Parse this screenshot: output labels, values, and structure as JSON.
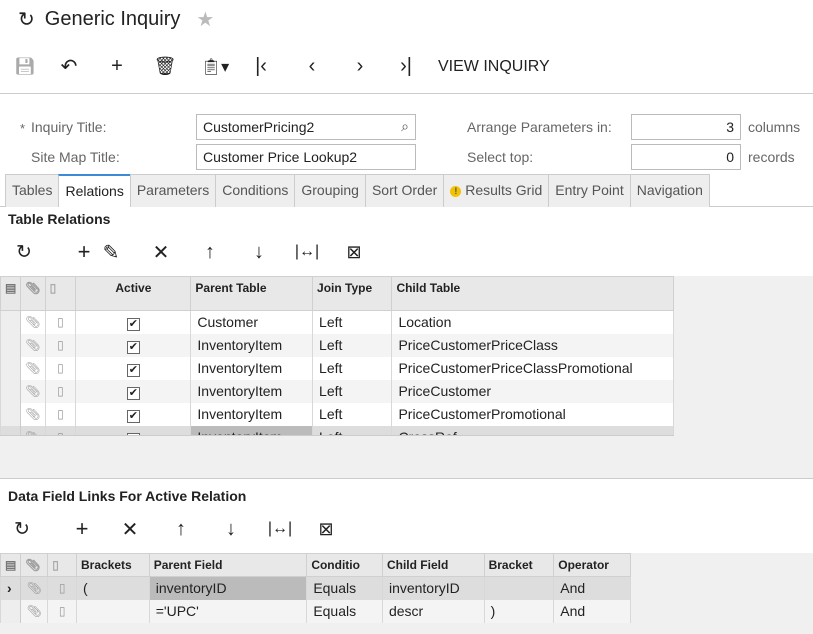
{
  "header": {
    "title": "Generic Inquiry",
    "view_inquiry": "VIEW INQUIRY"
  },
  "form": {
    "inquiry_title_label": "Inquiry Title:",
    "inquiry_title": "CustomerPricing2",
    "site_map_title_label": "Site Map Title:",
    "site_map_title": "Customer Price Lookup2",
    "arrange_label": "Arrange Parameters in:",
    "arrange_value": "3",
    "arrange_unit": "columns",
    "select_top_label": "Select top:",
    "select_top_value": "0",
    "select_top_unit": "records",
    "required_mark": "*"
  },
  "tabs": [
    "Tables",
    "Relations",
    "Parameters",
    "Conditions",
    "Grouping",
    "Sort Order",
    "Results Grid",
    "Entry Point",
    "Navigation"
  ],
  "active_tab": "Relations",
  "relations": {
    "title": "Table Relations",
    "columns": [
      "Active",
      "Parent Table",
      "Join Type",
      "Child Table"
    ],
    "rows": [
      {
        "active": true,
        "parent": "Customer",
        "join": "Left",
        "child": "Location"
      },
      {
        "active": true,
        "parent": "InventoryItem",
        "join": "Left",
        "child": "PriceCustomerPriceClass"
      },
      {
        "active": true,
        "parent": "InventoryItem",
        "join": "Left",
        "child": "PriceCustomerPriceClassPromotional"
      },
      {
        "active": true,
        "parent": "InventoryItem",
        "join": "Left",
        "child": "PriceCustomer"
      },
      {
        "active": true,
        "parent": "InventoryItem",
        "join": "Left",
        "child": "PriceCustomerPromotional"
      },
      {
        "active": true,
        "parent": "InventoryItem",
        "join": "Left",
        "child": "CrossRef"
      }
    ]
  },
  "links": {
    "title": "Data Field Links For Active Relation",
    "columns": [
      "Brackets",
      "Parent Field",
      "Conditio",
      "Child Field",
      "Bracket",
      "Operator"
    ],
    "rows": [
      {
        "brackets": "(",
        "parent": "inventoryID",
        "condition": "Equals",
        "child": "inventoryID",
        "bracket": "",
        "operator": "And"
      },
      {
        "brackets": "",
        "parent": "='UPC'",
        "condition": "Equals",
        "child": "descr",
        "bracket": ")",
        "operator": "And"
      }
    ]
  },
  "colors": {
    "accent": "#3b8bd6",
    "warning": "#f2c200"
  }
}
